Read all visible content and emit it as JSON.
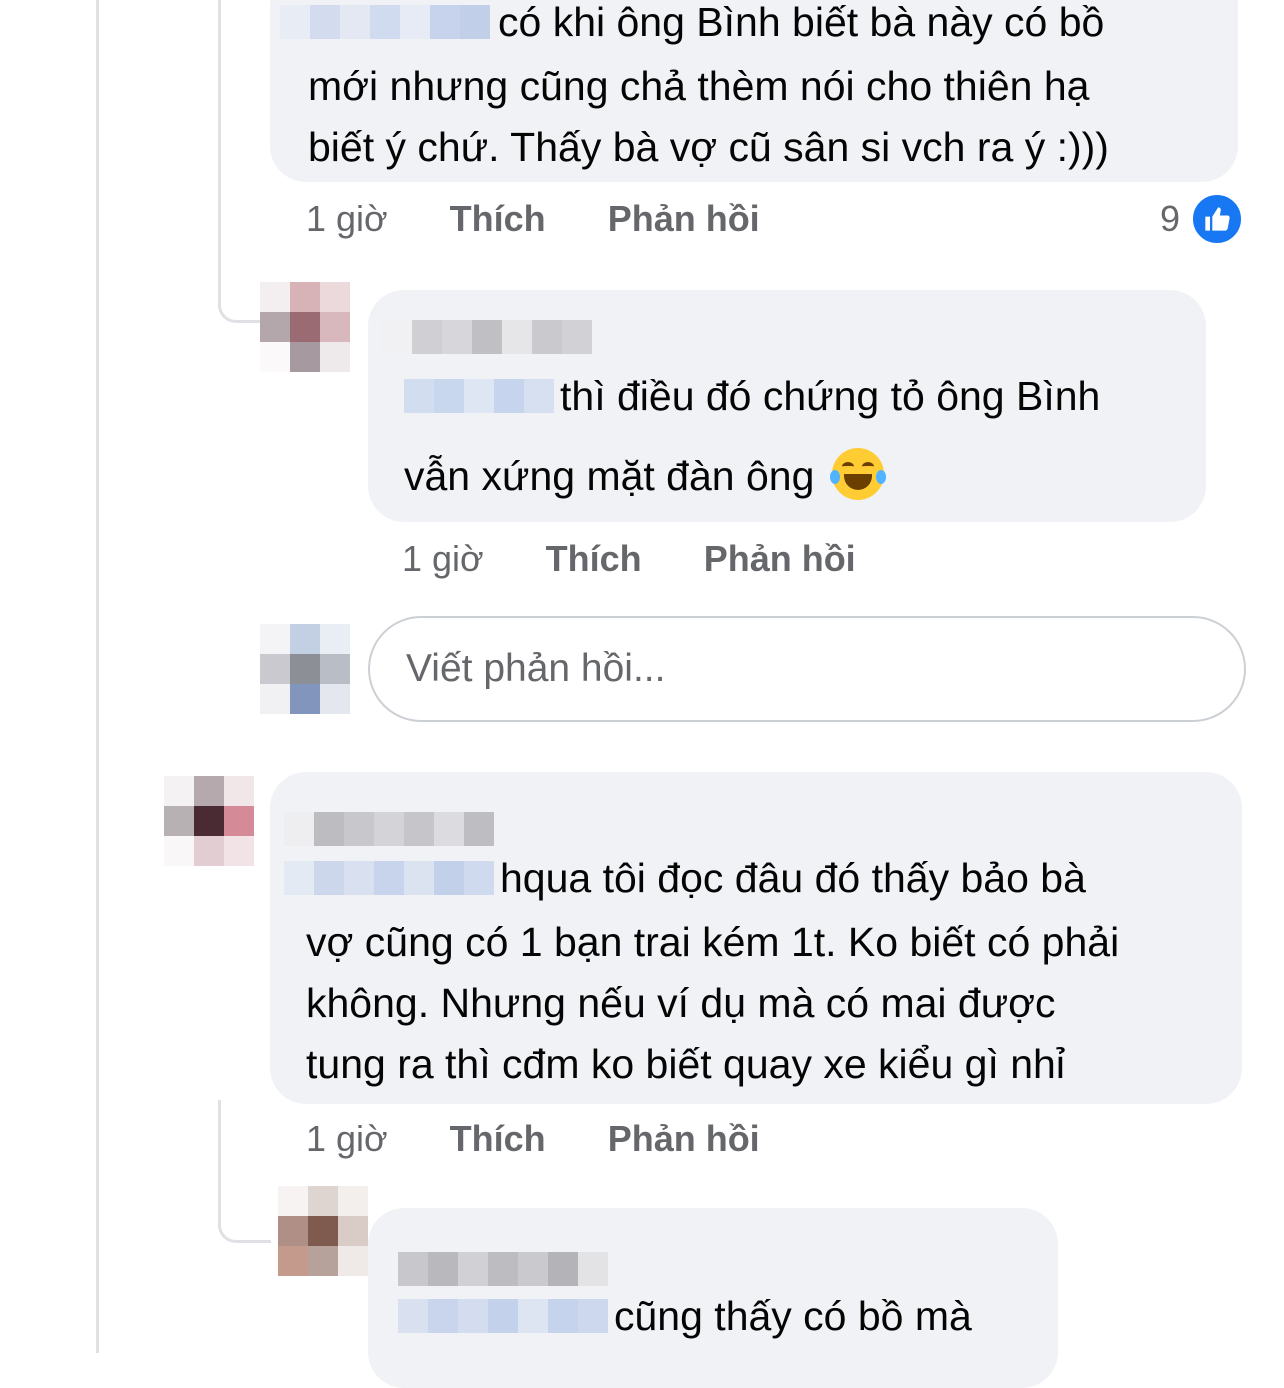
{
  "comments": [
    {
      "lines": [
        "có khi ông Bình biết bà này có bồ",
        "mới nhưng cũng chả thèm nói cho thiên hạ",
        "biết ý chứ. Thấy bà vợ cũ sân si vch ra ý :)))"
      ],
      "time": "1 giờ",
      "like_label": "Thích",
      "reply_label": "Phản hồi",
      "reaction_count": "9"
    },
    {
      "lines": [
        "thì điều đó chứng tỏ ông Bình",
        "vẫn xứng mặt đàn ông"
      ],
      "time": "1 giờ",
      "like_label": "Thích",
      "reply_label": "Phản hồi"
    },
    {
      "lines": [
        "hqua tôi đọc đâu đó thấy bảo bà",
        "vợ cũng có 1 bạn trai kém 1t. Ko biết có phải",
        "không. Nhưng nếu ví dụ mà có mai được",
        "tung ra thì cđm ko biết quay xe kiểu gì nhỉ"
      ],
      "time": "1 giờ",
      "like_label": "Thích",
      "reply_label": "Phản hồi"
    },
    {
      "lines": [
        "cũng thấy có bồ mà"
      ]
    }
  ],
  "reply_input": {
    "placeholder": "Viết phản hồi..."
  },
  "colors": {
    "like_blue": "#1877f2",
    "bubble": "#f0f2f5",
    "meta": "#65676b"
  },
  "icons": {
    "reaction": "like-thumbs-up-icon",
    "emoji": "face-with-tears-of-joy-icon"
  }
}
